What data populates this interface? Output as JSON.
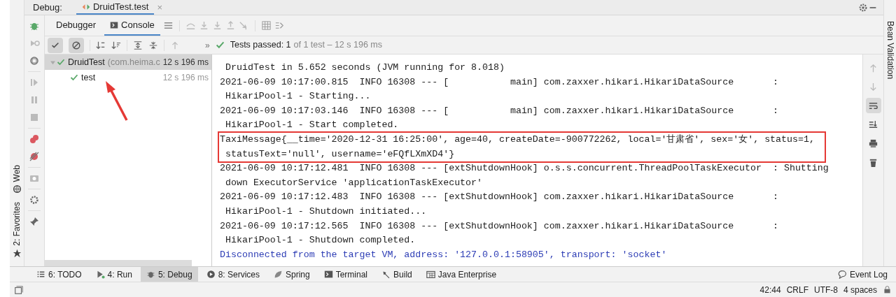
{
  "header": {
    "label": "Debug:",
    "tab": {
      "label": "DruidTest.test",
      "close": "×",
      "selected": true
    }
  },
  "debug_tabs": [
    {
      "label": "Debugger",
      "selected": false
    },
    {
      "label": "Console",
      "selected": true
    }
  ],
  "test_bar": {
    "more": "»",
    "passed": "Tests passed: 1",
    "detail": "of 1 test – 12 s 196 ms"
  },
  "tree": [
    {
      "label": "DruidTest",
      "detail": "(com.heima.c",
      "time": "12 s 196 ms",
      "selected": true,
      "expanded": true,
      "children": [
        {
          "label": "test",
          "time": "12 s 196 ms",
          "selected": false
        }
      ]
    }
  ],
  "console": [
    {
      "kind": "log",
      "text": " DruidTest in 5.652 seconds (JVM running for 8.018)"
    },
    {
      "kind": "log",
      "text": "2021-06-09 10:17:00.815  INFO 16308 --- [           main] com.zaxxer.hikari.HikariDataSource       :"
    },
    {
      "kind": "log",
      "text": " HikariPool-1 - Starting..."
    },
    {
      "kind": "log",
      "text": "2021-06-09 10:17:03.146  INFO 16308 --- [           main] com.zaxxer.hikari.HikariDataSource       :"
    },
    {
      "kind": "log",
      "text": " HikariPool-1 - Start completed."
    },
    {
      "kind": "highlight",
      "text": "TaxiMessage{__time='2020-12-31 16:25:00', age=40, createDate=-900772262, local='甘肃省', sex='女', status=1,",
      "cont": " statusText='null', username='eFQfLXmXD4'}"
    },
    {
      "kind": "log",
      "text": "2021-06-09 10:17:12.481  INFO 16308 --- [extShutdownHook] o.s.s.concurrent.ThreadPoolTaskExecutor  : Shutting"
    },
    {
      "kind": "log",
      "text": " down ExecutorService 'applicationTaskExecutor'"
    },
    {
      "kind": "log",
      "text": "2021-06-09 10:17:12.483  INFO 16308 --- [extShutdownHook] com.zaxxer.hikari.HikariDataSource       :"
    },
    {
      "kind": "log",
      "text": " HikariPool-1 - Shutdown initiated..."
    },
    {
      "kind": "log",
      "text": "2021-06-09 10:17:12.565  INFO 16308 --- [extShutdownHook] com.zaxxer.hikari.HikariDataSource       :"
    },
    {
      "kind": "log",
      "text": " HikariPool-1 - Shutdown completed."
    },
    {
      "kind": "system",
      "text": "Disconnected from the target VM, address: '127.0.0.1:58905', transport: 'socket'"
    }
  ],
  "side_tabs": [
    {
      "label": "2: Favorites"
    },
    {
      "label": "Web"
    }
  ],
  "right_tab": "Bean Validation",
  "tool_windows": [
    {
      "label": "6: TODO",
      "selected": false
    },
    {
      "label": "4: Run",
      "selected": false
    },
    {
      "label": "5: Debug",
      "selected": true
    },
    {
      "label": "8: Services",
      "selected": false
    },
    {
      "label": "Spring",
      "selected": false
    },
    {
      "label": "Terminal",
      "selected": false
    },
    {
      "label": "Build",
      "selected": false
    },
    {
      "label": "Java Enterprise",
      "selected": false
    }
  ],
  "event_log": "Event Log",
  "status": [
    "42:44",
    "CRLF",
    "UTF-8",
    "4 spaces"
  ]
}
